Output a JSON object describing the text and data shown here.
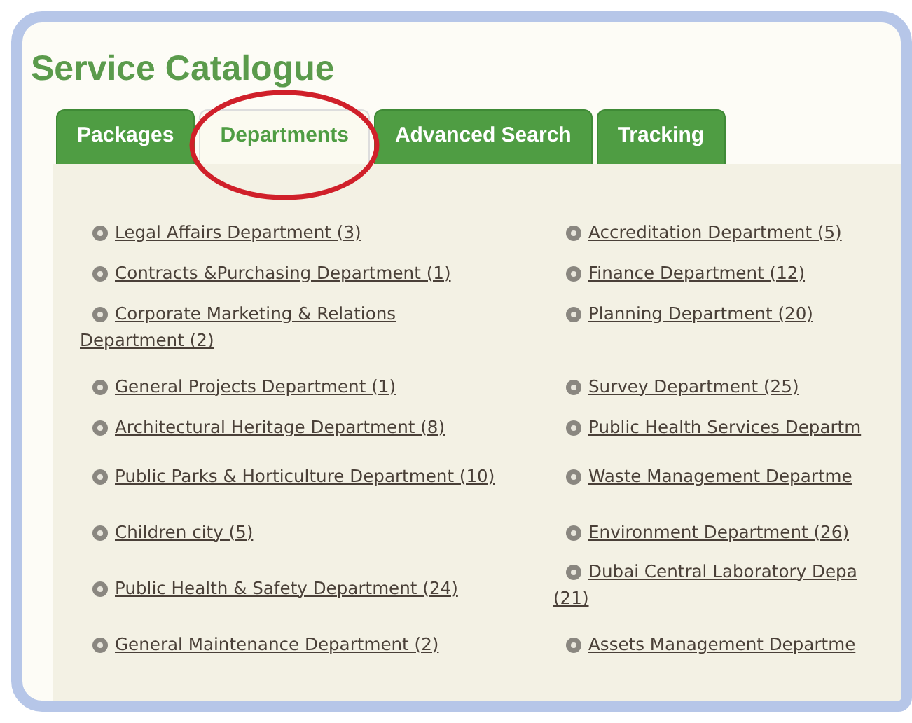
{
  "title": "Service Catalogue",
  "tabs": [
    {
      "label": "Packages",
      "selected": false,
      "circled": false
    },
    {
      "label": "Departments",
      "selected": true,
      "circled": true
    },
    {
      "label": "Advanced Search",
      "selected": false,
      "circled": false
    },
    {
      "label": "Tracking",
      "selected": false,
      "circled": false
    }
  ],
  "rows": [
    {
      "left": "Legal Affairs Department (3)",
      "right": "Accreditation Department (5)"
    },
    {
      "left": "Contracts &Purchasing Department (1)",
      "right": "Finance Department (12)"
    },
    {
      "left": "Corporate Marketing & Relations\nDepartment (2)",
      "right": "Planning Department (20)"
    },
    {
      "left": "General Projects Department (1)",
      "right": "Survey Department (25)"
    },
    {
      "left": "Architectural Heritage Department (8)",
      "right": "Public Health Services Departm"
    },
    {
      "left": "Public Parks & Horticulture Department (10)",
      "right": "Waste Management Departme"
    },
    {
      "left": "Children city (5)",
      "right": "Environment Department (26)"
    },
    {
      "left": "Public Health & Safety Department (24)",
      "right": "Dubai Central Laboratory Depa\n(21)"
    },
    {
      "left": "General Maintenance Department (2)",
      "right": "Assets Management Departme"
    }
  ]
}
